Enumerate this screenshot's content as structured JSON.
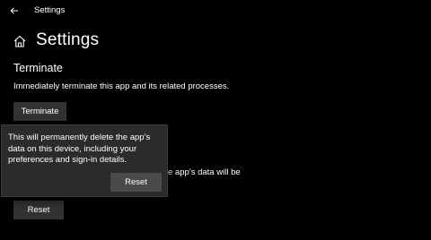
{
  "window": {
    "title": "Settings"
  },
  "header": {
    "page_title": "Settings"
  },
  "terminate": {
    "heading": "Terminate",
    "description": "Immediately terminate this app and its related processes.",
    "button_label": "Terminate"
  },
  "reset": {
    "description_partial": "e app’s data will be",
    "button_label": "Reset"
  },
  "flyout": {
    "message": "This will permanently delete the app’s data on this device, including your preferences and sign-in details.",
    "confirm_label": "Reset"
  },
  "icons": {
    "back": "back-arrow-icon",
    "home": "home-icon"
  }
}
